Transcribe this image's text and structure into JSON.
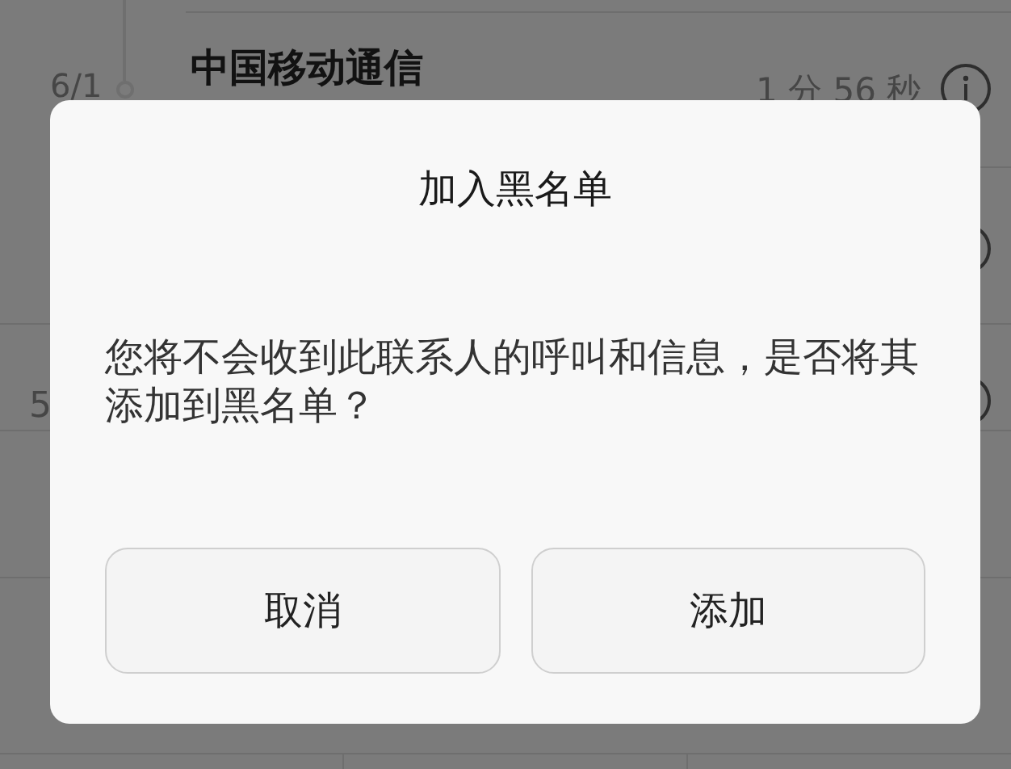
{
  "call_log": {
    "rows": [
      {
        "date": "6/1",
        "name": "中国移动通信",
        "duration": "1 分 56 秒"
      },
      {
        "date": "5"
      }
    ]
  },
  "dialog": {
    "title": "加入黑名单",
    "message": "您将不会收到此联系人的呼叫和信息，是否将其添加到黑名单？",
    "buttons": [
      "取消",
      "添加"
    ]
  }
}
